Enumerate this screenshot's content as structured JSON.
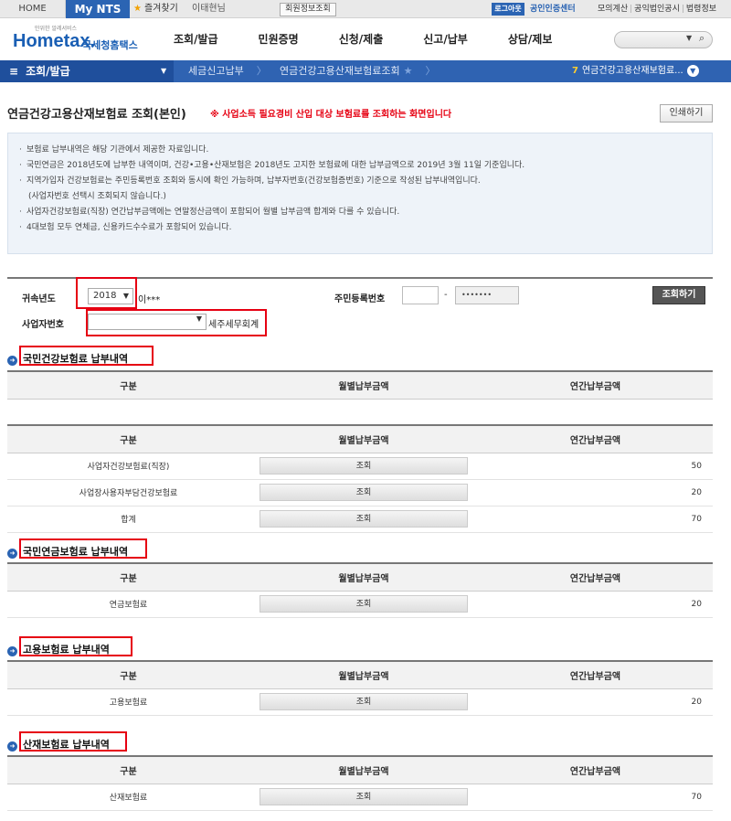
{
  "topbar": {
    "home": "HOME",
    "mynts": "My NTS",
    "favorites": "즐겨찾기",
    "user": "이태현님",
    "member_info": "회원정보조회",
    "logout": "로그아웃",
    "cert_center": "공인인증센터",
    "links": [
      "모의계산",
      "공익법인공시",
      "법령정보"
    ]
  },
  "header": {
    "logo_tagline": "만위한 알레서비스",
    "logo_brand": "Hometax.",
    "logo_kr": "국세청홈택스",
    "menu": [
      "조회/발급",
      "민원증명",
      "신청/제출",
      "신고/납부",
      "상담/제보"
    ]
  },
  "navbar": {
    "menu_label": "조회/발급",
    "breadcrumb": [
      "세금신고납부",
      "연금건강고용산재보험료조회"
    ],
    "recent_count": "7",
    "recent_label": "연금건강고용산재보험료..."
  },
  "page": {
    "title": "연금건강고용산재보험료 조회(본인)",
    "note": "※ 사업소득 필요경비 산입 대상 보험료를 조회하는 화면입니다",
    "print_button": "인쇄하기"
  },
  "info": [
    "보험료 납부내역은 해당 기관에서 제공한 자료입니다.",
    "국민연금은 2018년도에 납부한 내역이며, 건강•고용•산재보험은 2018년도 고지한 보험료에 대한 납부금액으로 2019년 3월 11일 기준입니다.",
    "지역가입자 건강보험료는 주민등록번호 조회와 동시에 확인 가능하며, 납부자번호(건강보험증번호) 기준으로 작성된 납부내역입니다.",
    "(사업자번호 선택시 조회되지 않습니다.)",
    "사업자건강보험료(직장) 연간납부금액에는 연말정산금액이 포함되어 월별 납부금액 합계와 다를 수 있습니다.",
    "4대보험 모두 연체금, 신용카드수수료가 포함되어 있습니다."
  ],
  "form": {
    "year_label": "귀속년도",
    "year_value": "2018",
    "name_masked": "이***",
    "rrn_label": "주민등록번호",
    "rrn_back": "•••••••",
    "query_button": "조회하기",
    "biz_label": "사업자번호",
    "biz_value": "",
    "biz_name": "세주세무회계"
  },
  "columns": [
    "구분",
    "월별납부금액",
    "연간납부금액"
  ],
  "view_label": "조회",
  "sections": {
    "health": {
      "title": "국민건강보험료 납부내역",
      "rows": [
        {
          "label": "사업자건강보험료(직장)",
          "amount": "50"
        },
        {
          "label": "사업장사용자부담건강보험료",
          "amount": "20"
        },
        {
          "label": "합계",
          "amount": "70"
        }
      ]
    },
    "pension": {
      "title": "국민연금보험료 납부내역",
      "rows": [
        {
          "label": "연금보험료",
          "amount": "20"
        }
      ]
    },
    "employment": {
      "title": "고용보험료 납부내역",
      "rows": [
        {
          "label": "고용보험료",
          "amount": "20"
        }
      ]
    },
    "industrial": {
      "title": "산재보험료 납부내역",
      "rows": [
        {
          "label": "산재보험료",
          "amount": "70"
        }
      ]
    }
  },
  "colors": {
    "brand_blue": "#2b64b3",
    "highlight_red": "#e60012"
  }
}
